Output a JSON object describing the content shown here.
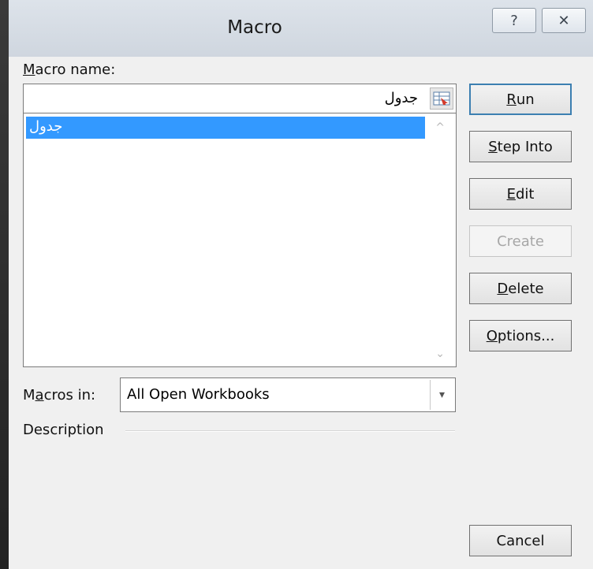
{
  "window": {
    "title": "Macro",
    "help_glyph": "?",
    "close_glyph": "✕"
  },
  "macro_name": {
    "label_underlined": "M",
    "label_rest": "acro name:",
    "value": "جدول",
    "collapse_icon": "range-selector-icon"
  },
  "macro_list": {
    "items": [
      "جدول"
    ],
    "selected_index": 0,
    "scroll_up": "^",
    "scroll_down": "⌄"
  },
  "buttons": {
    "run": {
      "u": "R",
      "rest": "un"
    },
    "step_into": {
      "u": "S",
      "rest": "tep Into"
    },
    "edit": {
      "u": "E",
      "rest": "dit"
    },
    "create": "Create",
    "delete": {
      "u": "D",
      "rest": "elete"
    },
    "options": {
      "u": "O",
      "rest": "ptions..."
    },
    "cancel": "Cancel"
  },
  "macros_in": {
    "label_pre": "M",
    "label_u": "a",
    "label_post": "cros in:",
    "value": "All Open Workbooks",
    "dropdown_glyph": "▾"
  },
  "description": {
    "label": "Description"
  },
  "colors": {
    "selection": "#3399ff",
    "titlebar": "#d6dde6",
    "default_button_border": "#3c7fb1"
  }
}
